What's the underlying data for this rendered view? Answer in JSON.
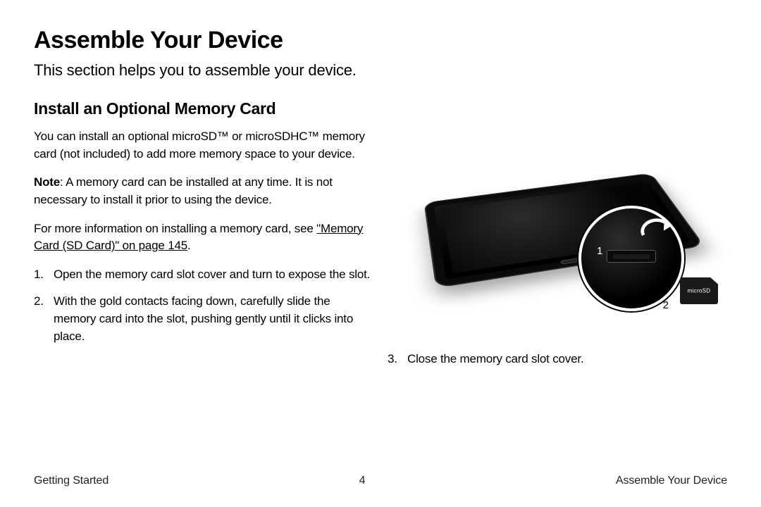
{
  "heading": "Assemble Your Device",
  "intro": "This section helps you to assemble your device.",
  "section": {
    "title": "Install an Optional Memory Card",
    "p1": "You can install an optional microSD™ or microSDHC™ memory card (not included) to add more memory space to your device.",
    "note_label": "Note",
    "note_text": ": A memory card can be installed at any time. It is not necessary to install it prior to using the device.",
    "p3_pre": "For more information on installing a memory card, see ",
    "p3_link": "\"Memory Card (SD Card)\" on page 145",
    "p3_post": ".",
    "steps": [
      "Open the memory card slot cover and turn to expose the slot.",
      "With the gold contacts facing down, carefully slide the memory card into the slot, pushing gently until it clicks into place.",
      "Close the memory card slot cover."
    ]
  },
  "illustration": {
    "callout_1": "1",
    "callout_2": "2",
    "sd_label": "microSD"
  },
  "footer": {
    "left": "Getting Started",
    "page": "4",
    "right": "Assemble Your Device"
  }
}
